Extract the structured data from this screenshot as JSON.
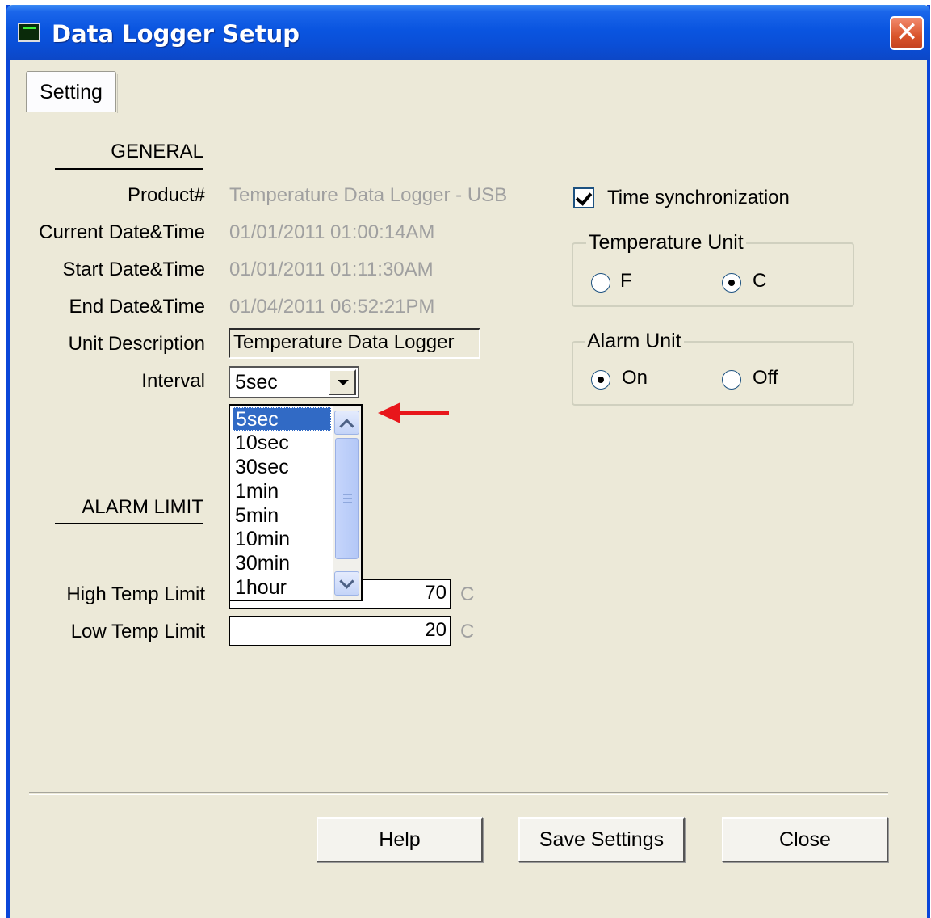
{
  "window": {
    "title": "Data Logger Setup",
    "close_glyph": "✕"
  },
  "tabs": [
    {
      "label": "Setting",
      "active": true
    }
  ],
  "general": {
    "section_title": "GENERAL",
    "product_label": "Product#",
    "product_value": "Temperature Data Logger - USB",
    "current_label": "Current Date&Time",
    "current_value": "01/01/2011 01:00:14AM",
    "start_label": "Start Date&Time",
    "start_value": "01/01/2011 01:11:30AM",
    "end_label": "End Date&Time",
    "end_value": "01/04/2011 06:52:21PM",
    "unit_desc_label": "Unit Description",
    "unit_desc_value": "Temperature Data Logger",
    "interval_label": "Interval",
    "interval_value": "5sec",
    "interval_options": [
      "5sec",
      "10sec",
      "30sec",
      "1min",
      "5min",
      "10min",
      "30min",
      "1hour"
    ]
  },
  "alarm_limit": {
    "section_title": "ALARM LIMIT",
    "high_label": "High Temp Limit",
    "high_value": "70",
    "high_unit": "C",
    "low_label": "Low Temp Limit",
    "low_value": "20",
    "low_unit": "C"
  },
  "time_sync": {
    "label": "Time synchronization",
    "checked": true
  },
  "temperature_unit": {
    "legend": "Temperature Unit",
    "option_f": "F",
    "option_c": "C",
    "selected": "C"
  },
  "alarm_unit": {
    "legend": "Alarm Unit",
    "option_on": "On",
    "option_off": "Off",
    "selected": "On"
  },
  "buttons": {
    "help": "Help",
    "save": "Save Settings",
    "close": "Close"
  },
  "colors": {
    "titlebar": "#0a55e0",
    "dialog_bg": "#ece9d8",
    "selection": "#316ac5",
    "annotation_arrow": "#e8161b"
  }
}
